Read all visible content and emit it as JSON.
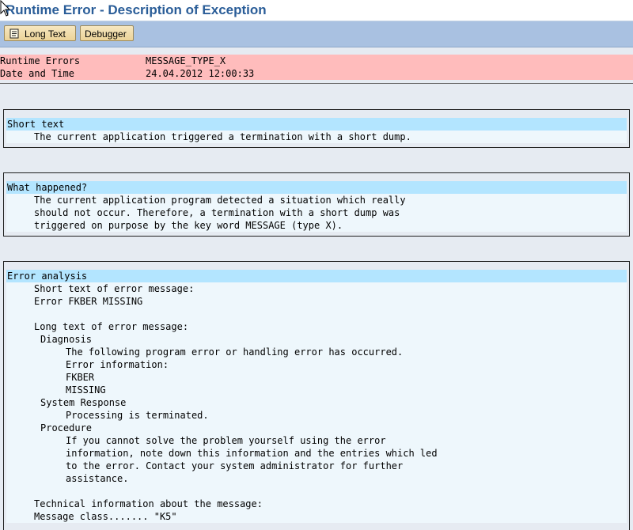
{
  "window": {
    "title": "Runtime Error - Description of Exception"
  },
  "toolbar": {
    "long_text_label": "Long Text",
    "debugger_label": "Debugger"
  },
  "header_rows": [
    {
      "label": "Runtime Errors",
      "value": "MESSAGE_TYPE_X"
    },
    {
      "label": "Date and Time",
      "value": "24.04.2012 12:00:33"
    }
  ],
  "sections": {
    "short_text": {
      "heading": "Short text",
      "lines": [
        "The current application triggered a termination with a short dump."
      ]
    },
    "what_happened": {
      "heading": "What happened?",
      "lines": [
        "The current application program detected a situation which really",
        "should not occur. Therefore, a termination with a short dump was",
        "triggered on purpose by the key word MESSAGE (type X)."
      ]
    },
    "error_analysis": {
      "heading": "Error analysis",
      "lines": [
        "Short text of error message:",
        "Error FKBER MISSING",
        "",
        "Long text of error message:",
        "Diagnosis",
        "The following program error or handling error has occurred.",
        "Error information:",
        "FKBER",
        "MISSING",
        "System Response",
        "Processing is terminated.",
        "Procedure",
        "If you cannot solve the problem yourself using the error",
        "information, note down this information and the entries which led",
        "to the error. Contact your system administrator for further",
        "assistance.",
        "",
        "Technical information about the message:",
        "Message class....... \"K5\""
      ]
    }
  }
}
